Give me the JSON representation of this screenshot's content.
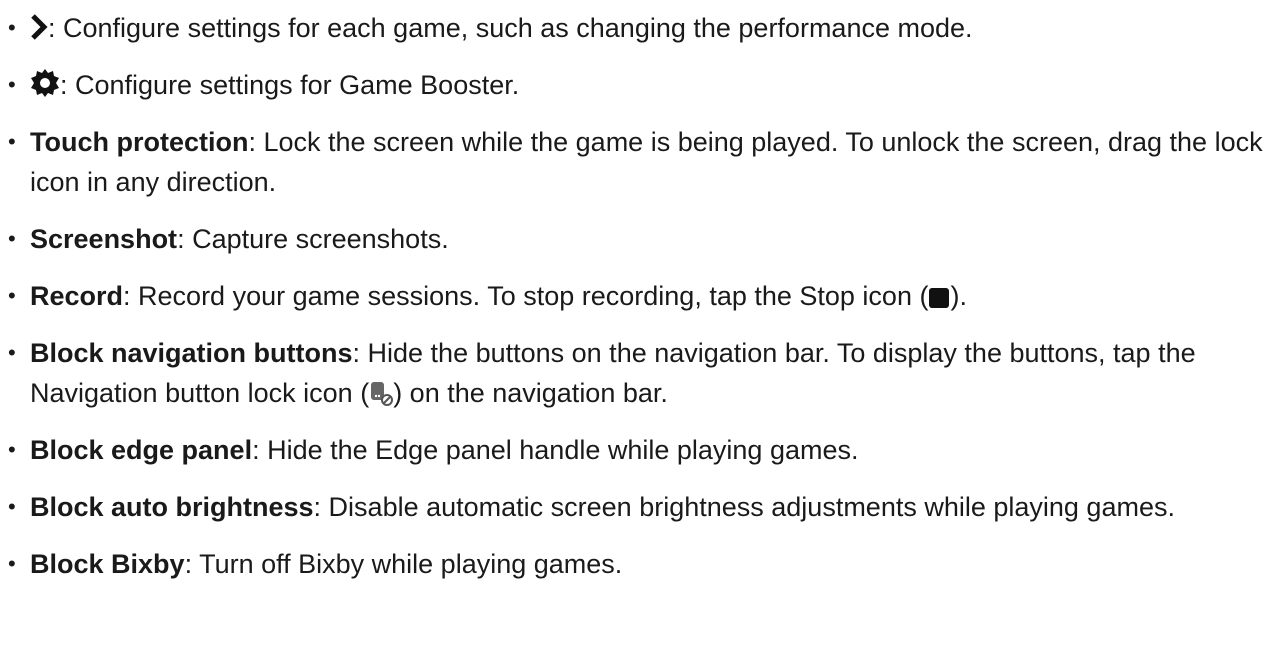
{
  "items": [
    {
      "icon": "chevron-right-icon",
      "text": ": Configure settings for each game, such as changing the performance mode."
    },
    {
      "icon": "gear-icon",
      "text": ": Configure settings for Game Booster."
    },
    {
      "term": "Touch protection",
      "text": ": Lock the screen while the game is being played. To unlock the screen, drag the lock icon in any direction."
    },
    {
      "term": "Screenshot",
      "text": ": Capture screenshots."
    },
    {
      "term": "Record",
      "text_before": ": Record your game sessions. To stop recording, tap the Stop icon (",
      "icon": "stop-icon",
      "text_after": ")."
    },
    {
      "term": "Block navigation buttons",
      "text_before": ": Hide the buttons on the navigation bar. To display the buttons, tap the Navigation button lock icon (",
      "icon": "navigation-lock-icon",
      "text_after": ") on the navigation bar."
    },
    {
      "term": "Block edge panel",
      "text": ": Hide the Edge panel handle while playing games."
    },
    {
      "term": "Block auto brightness",
      "text": ": Disable automatic screen brightness adjustments while playing games."
    },
    {
      "term": "Block Bixby",
      "text": ": Turn off Bixby while playing games."
    }
  ],
  "bullet": "•"
}
